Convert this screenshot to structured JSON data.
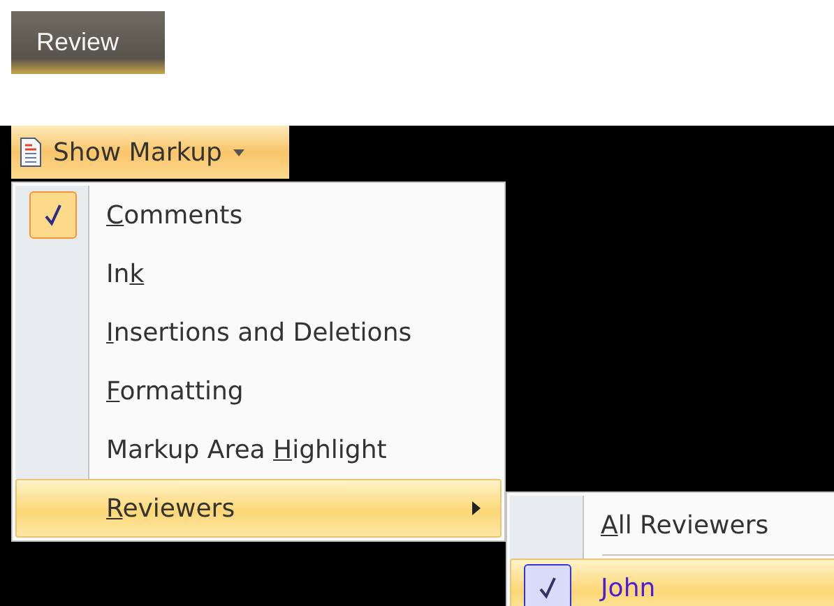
{
  "tab": {
    "label": "Review"
  },
  "show_markup": {
    "label": "Show Markup"
  },
  "menu": {
    "items": [
      {
        "label": {
          "key": "C",
          "after": "omments"
        },
        "checked": true,
        "selected": false,
        "has_submenu": false
      },
      {
        "label": {
          "before": "In",
          "key": "k"
        },
        "checked": false,
        "selected": false,
        "has_submenu": false
      },
      {
        "label": {
          "key": "I",
          "after": "nsertions and Deletions"
        },
        "checked": false,
        "selected": false,
        "has_submenu": false
      },
      {
        "label": {
          "key": "F",
          "after": "ormatting"
        },
        "checked": false,
        "selected": false,
        "has_submenu": false
      },
      {
        "label": {
          "before": "Markup Area ",
          "key": "H",
          "after": "ighlight"
        },
        "checked": false,
        "selected": false,
        "has_submenu": false
      },
      {
        "label": {
          "key": "R",
          "after": "eviewers"
        },
        "checked": false,
        "selected": true,
        "has_submenu": true
      }
    ]
  },
  "submenu": {
    "items": [
      {
        "label": {
          "key": "A",
          "after": "ll Reviewers"
        },
        "checked": false,
        "selected": false
      },
      {
        "label": {
          "after": "John"
        },
        "checked": true,
        "selected": true,
        "color": "#4a1ed8"
      }
    ]
  }
}
